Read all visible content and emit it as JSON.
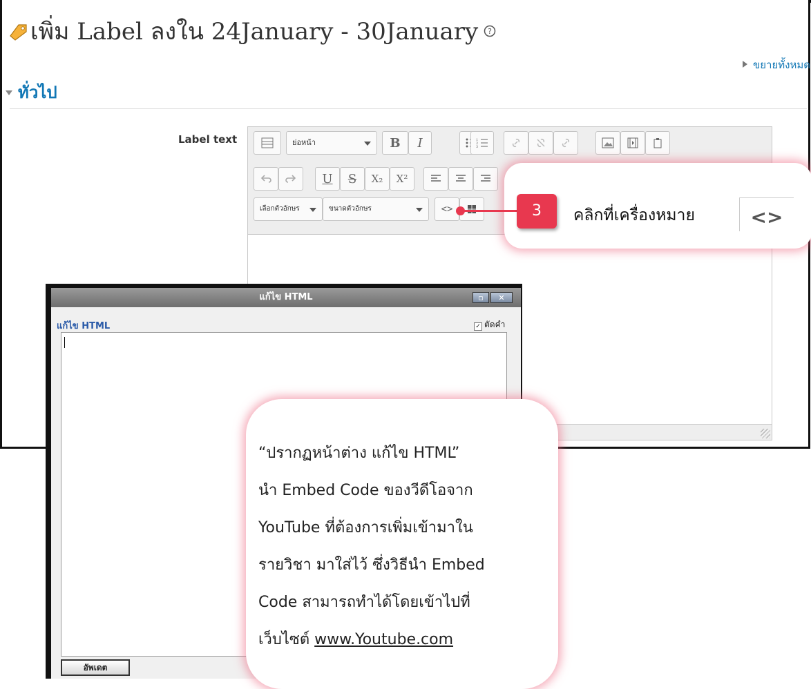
{
  "header": {
    "title": "เพิ่ม Label ลงใน 24January - 30January",
    "expand_all": "ขยายทั้งหมด"
  },
  "section": {
    "title": "ทั่วไป"
  },
  "form": {
    "label_text": "Label text"
  },
  "toolbar": {
    "paragraph_select": "ย่อหน้า",
    "font_select": "เลือกตัวอักษร",
    "size_select": "ขนาดตัวอักษร",
    "bold": "B",
    "italic": "I",
    "underline": "U",
    "strike": "S",
    "subscript": "X₂",
    "superscript": "X²",
    "html_button": "<>"
  },
  "dialog": {
    "title": "แก้ไข HTML",
    "label": "แก้ไข HTML",
    "wrap_option": "ตัดคำ",
    "update_button": "อัพเดต",
    "minimize": "▫",
    "close": "✕"
  },
  "annotation": {
    "step_number": "3",
    "click_instruction": "คลิกที่เครื่องหมาย",
    "code_symbol": "<>",
    "description_lines": [
      "“ปรากฏหน้าต่าง แก้ไข HTML”",
      "นำ Embed Code ของวีดีโอจาก",
      "YouTube ที่ต้องการเพิ่มเข้ามาใน",
      "รายวิชา มาใส่ไว้ ซึ่งวิธีนำ Embed",
      "Code สามารถทำได้โดยเข้าไปที่"
    ],
    "description_last_prefix": "เว็บไซต์ ",
    "description_link": "www.Youtube.com"
  },
  "colors": {
    "accent_blue": "#1177b5",
    "callout_red": "#e8384f",
    "glow_pink": "#ec647d"
  }
}
